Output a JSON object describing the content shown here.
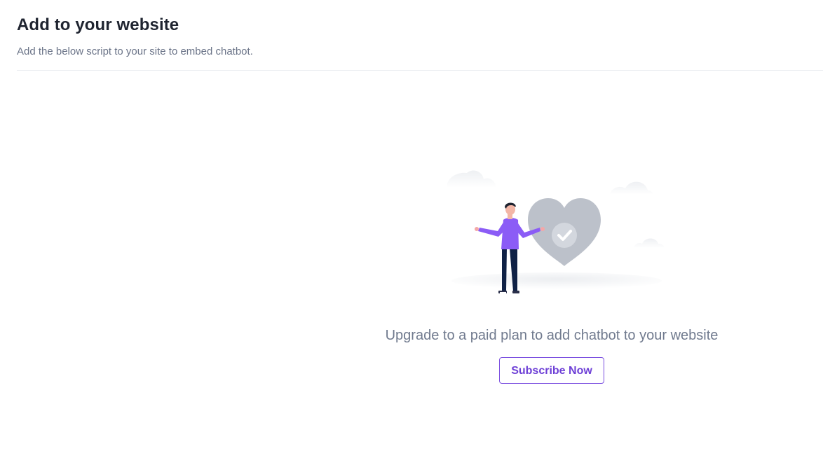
{
  "header": {
    "title": "Add to your website",
    "subtitle": "Add the below script to your site to embed chatbot."
  },
  "empty_state": {
    "message": "Upgrade to a paid plan to add chatbot to your website",
    "cta_label": "Subscribe Now",
    "illustration_icons": [
      "person-icon",
      "heart-check-icon",
      "cloud-icon"
    ]
  },
  "colors": {
    "accent": "#7b4fe0",
    "title": "#1f2430",
    "muted_text": "#6b7488",
    "heart": "#bcc1ca",
    "shirt": "#8b5cf6",
    "pants": "#0f2145"
  }
}
